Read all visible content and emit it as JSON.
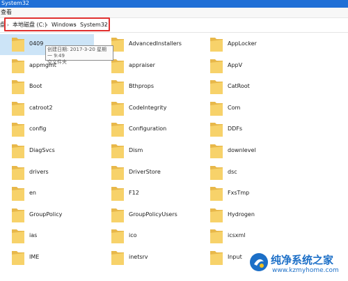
{
  "window": {
    "title": "System32"
  },
  "menubar": {
    "label": "查看"
  },
  "address": {
    "crumbs": [
      "本地磁盘 (C:)",
      "Windows",
      "System32"
    ],
    "prefix": "盘"
  },
  "folders": [
    {
      "name": "0409"
    },
    {
      "name": "AdvancedInstallers"
    },
    {
      "name": "AppLocker"
    },
    {
      "name": "appmgmt"
    },
    {
      "name": "appraiser"
    },
    {
      "name": "AppV"
    },
    {
      "name": "Boot"
    },
    {
      "name": "Bthprops"
    },
    {
      "name": "CatRoot"
    },
    {
      "name": "catroot2"
    },
    {
      "name": "CodeIntegrity"
    },
    {
      "name": "Com"
    },
    {
      "name": "config"
    },
    {
      "name": "Configuration"
    },
    {
      "name": "DDFs"
    },
    {
      "name": "DiagSvcs"
    },
    {
      "name": "Dism"
    },
    {
      "name": "downlevel"
    },
    {
      "name": "drivers"
    },
    {
      "name": "DriverStore"
    },
    {
      "name": "dsc"
    },
    {
      "name": "en"
    },
    {
      "name": "F12"
    },
    {
      "name": "FxsTmp"
    },
    {
      "name": "GroupPolicy"
    },
    {
      "name": "GroupPolicyUsers"
    },
    {
      "name": "Hydrogen"
    },
    {
      "name": "ias"
    },
    {
      "name": "ico"
    },
    {
      "name": "icsxml"
    },
    {
      "name": "IME"
    },
    {
      "name": "inetsrv"
    },
    {
      "name": "Input"
    }
  ],
  "tooltip": {
    "line1": "创建日期: 2017-3-20 星期一 9:49",
    "line2": "空文件夹"
  },
  "watermark": {
    "title": "纯净系统之家",
    "url": "www.kzmyhome.com"
  },
  "colors": {
    "titlebar": "#1f6fd6",
    "highlight_frame": "#e0302f",
    "selection": "#cce4f7",
    "folder_body": "#f7d26a",
    "folder_back": "#e8b84a"
  }
}
